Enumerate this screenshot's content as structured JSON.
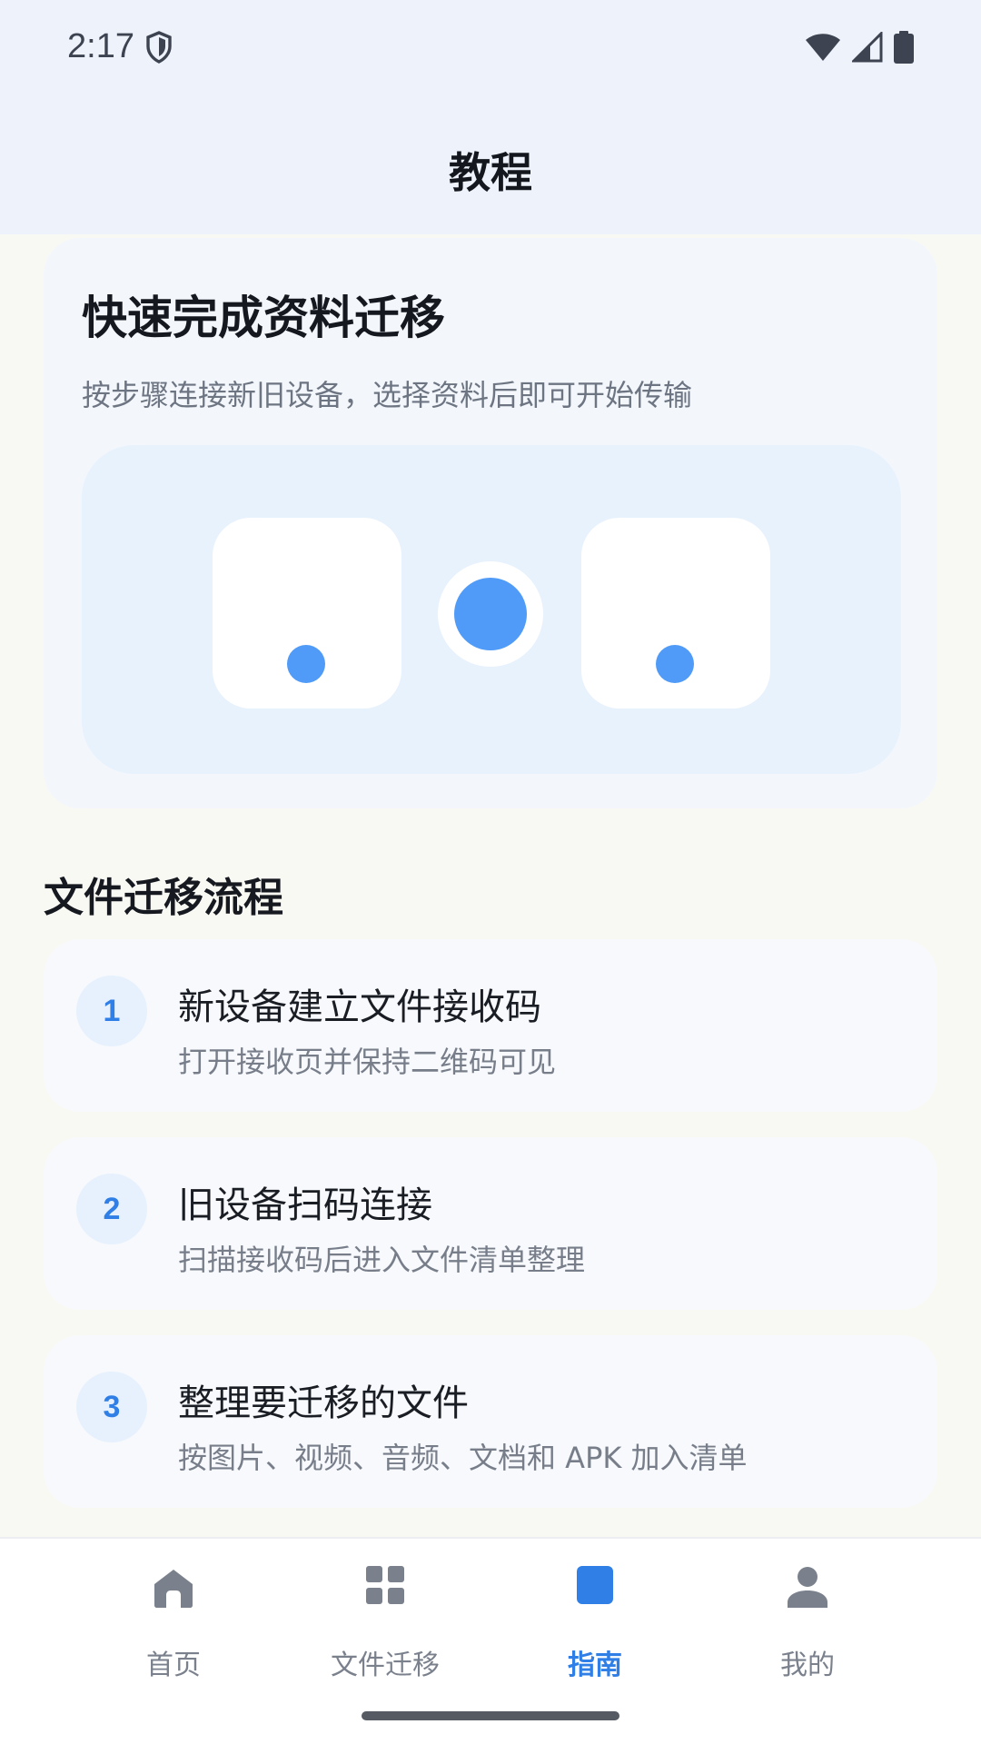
{
  "status_bar": {
    "time": "2:17",
    "icons": [
      "shield-icon",
      "wifi-icon",
      "cellular-signal-icon",
      "battery-icon"
    ]
  },
  "header": {
    "title": "教程"
  },
  "hero": {
    "title": "快速完成资料迁移",
    "subtitle": "按步骤连接新旧设备，选择资料后即可开始传输"
  },
  "flow": {
    "title": "文件迁移流程",
    "steps": [
      {
        "number": "1",
        "title": "新设备建立文件接收码",
        "description": "打开接收页并保持二维码可见"
      },
      {
        "number": "2",
        "title": "旧设备扫码连接",
        "description": "扫描接收码后进入文件清单整理"
      },
      {
        "number": "3",
        "title": "整理要迁移的文件",
        "description": "按图片、视频、音频、文档和 APK 加入清单"
      }
    ]
  },
  "nav": {
    "items": [
      {
        "label": "首页",
        "icon": "home-icon",
        "active": false
      },
      {
        "label": "文件迁移",
        "icon": "grid-icon",
        "active": false
      },
      {
        "label": "指南",
        "icon": "guide-icon",
        "active": true
      },
      {
        "label": "我的",
        "icon": "person-icon",
        "active": false
      }
    ]
  },
  "colors": {
    "accent": "#2f7fe6",
    "illustration_blue": "#4f9bf7",
    "header_bg": "#eef3fb",
    "page_bg": "#f9f9f4",
    "inactive": "#7a818c"
  }
}
